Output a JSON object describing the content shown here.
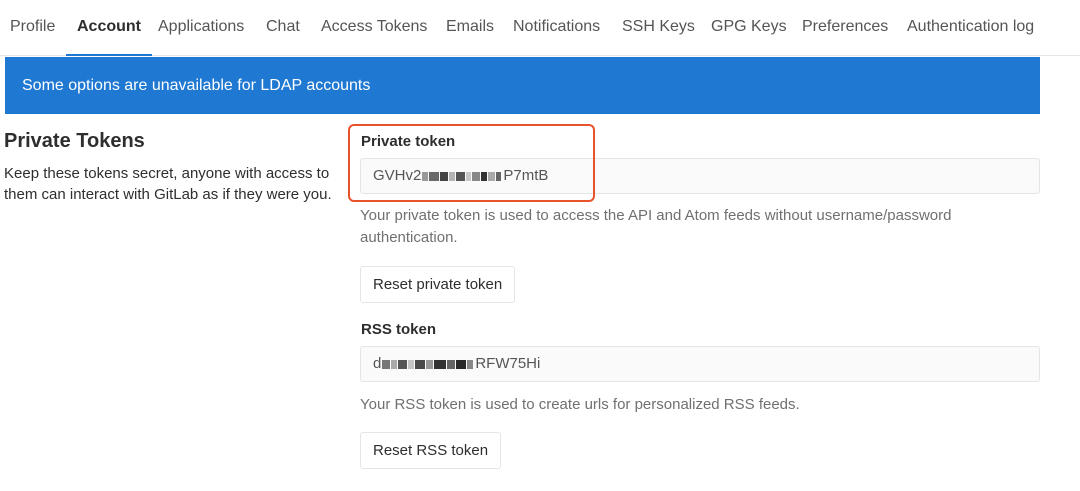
{
  "nav": {
    "tabs": [
      {
        "label": "Profile",
        "active": false
      },
      {
        "label": "Account",
        "active": true
      },
      {
        "label": "Applications",
        "active": false
      },
      {
        "label": "Chat",
        "active": false
      },
      {
        "label": "Access Tokens",
        "active": false
      },
      {
        "label": "Emails",
        "active": false
      },
      {
        "label": "Notifications",
        "active": false
      },
      {
        "label": "SSH Keys",
        "active": false
      },
      {
        "label": "GPG Keys",
        "active": false
      },
      {
        "label": "Preferences",
        "active": false
      },
      {
        "label": "Authentication log",
        "active": false
      }
    ]
  },
  "banner": {
    "text": "Some options are unavailable for LDAP accounts",
    "color": "#1f78d1"
  },
  "section": {
    "title": "Private Tokens",
    "description": "Keep these tokens secret, anyone with access to them can interact with GitLab as if they were you."
  },
  "private_token": {
    "label": "Private token",
    "value_prefix": "GVHv2",
    "value_suffix": "P7mtB",
    "help": "Your private token is used to access the API and Atom feeds without username/password authentication.",
    "reset_label": "Reset private token"
  },
  "rss_token": {
    "label": "RSS token",
    "value_prefix": "d",
    "value_suffix": "RFW75Hi",
    "help": "Your RSS token is used to create urls for personalized RSS feeds.",
    "reset_label": "Reset RSS token"
  },
  "highlight_color": "#e8532b"
}
